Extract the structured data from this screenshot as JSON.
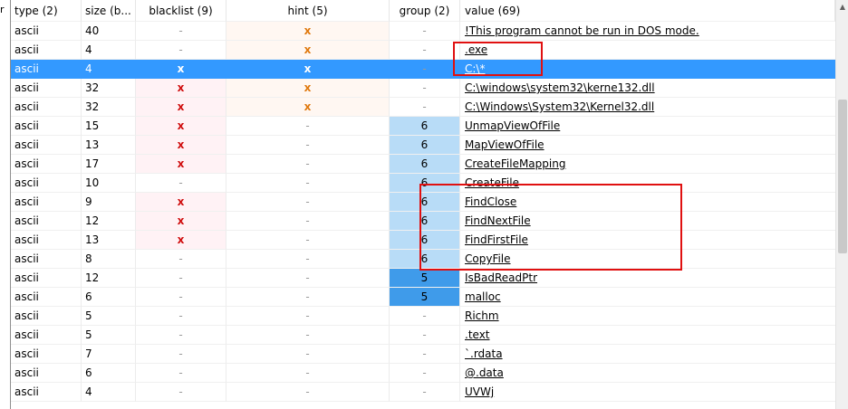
{
  "columns": {
    "type": "type (2)",
    "size": "size (b...",
    "blacklist": "blacklist (9)",
    "hint": "hint (5)",
    "group": "group (2)",
    "value": "value (69)"
  },
  "left_marker": "r",
  "rows": [
    {
      "type": "ascii",
      "size": "40",
      "blacklist": "-",
      "hint": "x",
      "group": "-",
      "value": "!This program cannot be run in DOS mode."
    },
    {
      "type": "ascii",
      "size": "4",
      "blacklist": "-",
      "hint": "x",
      "group": "-",
      "value": ".exe"
    },
    {
      "type": "ascii",
      "size": "4",
      "blacklist": "x",
      "hint": "x",
      "group": "-",
      "value": "C:\\*"
    },
    {
      "type": "ascii",
      "size": "32",
      "blacklist": "x",
      "hint": "x",
      "group": "-",
      "value": "C:\\windows\\system32\\kerne132.dll"
    },
    {
      "type": "ascii",
      "size": "32",
      "blacklist": "x",
      "hint": "x",
      "group": "-",
      "value": "C:\\Windows\\System32\\Kernel32.dll"
    },
    {
      "type": "ascii",
      "size": "15",
      "blacklist": "x",
      "hint": "-",
      "group": "6",
      "value": "UnmapViewOfFile"
    },
    {
      "type": "ascii",
      "size": "13",
      "blacklist": "x",
      "hint": "-",
      "group": "6",
      "value": "MapViewOfFile"
    },
    {
      "type": "ascii",
      "size": "17",
      "blacklist": "x",
      "hint": "-",
      "group": "6",
      "value": "CreateFileMapping"
    },
    {
      "type": "ascii",
      "size": "10",
      "blacklist": "-",
      "hint": "-",
      "group": "6",
      "value": "CreateFile"
    },
    {
      "type": "ascii",
      "size": "9",
      "blacklist": "x",
      "hint": "-",
      "group": "6",
      "value": "FindClose"
    },
    {
      "type": "ascii",
      "size": "12",
      "blacklist": "x",
      "hint": "-",
      "group": "6",
      "value": "FindNextFile"
    },
    {
      "type": "ascii",
      "size": "13",
      "blacklist": "x",
      "hint": "-",
      "group": "6",
      "value": "FindFirstFile"
    },
    {
      "type": "ascii",
      "size": "8",
      "blacklist": "-",
      "hint": "-",
      "group": "6",
      "value": "CopyFile"
    },
    {
      "type": "ascii",
      "size": "12",
      "blacklist": "-",
      "hint": "-",
      "group": "5",
      "value": "IsBadReadPtr"
    },
    {
      "type": "ascii",
      "size": "6",
      "blacklist": "-",
      "hint": "-",
      "group": "5",
      "value": "malloc"
    },
    {
      "type": "ascii",
      "size": "5",
      "blacklist": "-",
      "hint": "-",
      "group": "-",
      "value": "Richm"
    },
    {
      "type": "ascii",
      "size": "5",
      "blacklist": "-",
      "hint": "-",
      "group": "-",
      "value": ".text"
    },
    {
      "type": "ascii",
      "size": "7",
      "blacklist": "-",
      "hint": "-",
      "group": "-",
      "value": "`.rdata"
    },
    {
      "type": "ascii",
      "size": "6",
      "blacklist": "-",
      "hint": "-",
      "group": "-",
      "value": "@.data"
    },
    {
      "type": "ascii",
      "size": "4",
      "blacklist": "-",
      "hint": "-",
      "group": "-",
      "value": "UVWj"
    }
  ],
  "selected_row": 2,
  "colors": {
    "selection": "#3399ff",
    "group_6": "#b8dcf7",
    "group_5": "#3f9bea",
    "blacklist_x": "#d01010",
    "hint_x": "#e07a10",
    "annotation_box": "#e01010"
  }
}
